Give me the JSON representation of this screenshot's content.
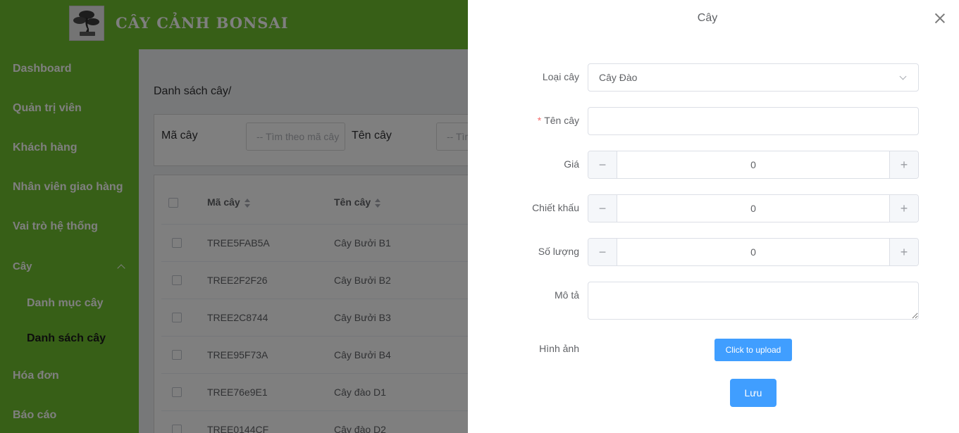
{
  "header": {
    "brand": "CÂY CẢNH BONSAI",
    "logo_icon": "bonsai-tree-icon"
  },
  "sidebar": {
    "items": [
      {
        "label": "Dashboard"
      },
      {
        "label": "Quản trị viên"
      },
      {
        "label": "Khách hàng"
      },
      {
        "label": "Nhân viên giao hàng"
      },
      {
        "label": "Vai trò hệ thống"
      },
      {
        "label": "Cây"
      },
      {
        "label": "Hóa đơn"
      },
      {
        "label": "Báo cáo"
      }
    ],
    "sub_items": [
      {
        "label": "Danh mục cây"
      },
      {
        "label": "Danh sách cây",
        "active": true
      }
    ]
  },
  "main": {
    "breadcrumb": "Danh sách cây/",
    "filters": {
      "code_label": "Mã cây",
      "code_placeholder": "-- Tìm theo mã cây",
      "name_label": "Tên cây",
      "name_placeholder": "-- Tìm theo tên cây"
    },
    "table": {
      "columns": [
        "Mã cây",
        "Tên cây"
      ],
      "rows": [
        {
          "code": "TREE5FAB5A",
          "name": "Cây Bưởi B1"
        },
        {
          "code": "TREE2F2F26",
          "name": "Cây Bưởi B2"
        },
        {
          "code": "TREE2C8744",
          "name": "Cây Bưởi B3"
        },
        {
          "code": "TREE95F73A",
          "name": "Cây Bưởi B4"
        },
        {
          "code": "TREE76e9E1",
          "name": "Cây đào D1"
        },
        {
          "code": "TREE0144CF",
          "name": "Cây đào D2"
        }
      ]
    }
  },
  "drawer": {
    "title": "Cây",
    "fields": {
      "category_label": "Loại cây",
      "category_value": "Cây Đào",
      "name_label": "Tên cây",
      "name_value": "",
      "price_label": "Giá",
      "price_value": "0",
      "discount_label": "Chiết khấu",
      "discount_value": "0",
      "quantity_label": "Số lượng",
      "quantity_value": "0",
      "description_label": "Mô tả",
      "description_value": "",
      "image_label": "Hình ảnh"
    },
    "upload_label": "Click to upload",
    "save_label": "Lưu",
    "stepper_minus": "−",
    "stepper_plus": "+"
  },
  "colors": {
    "brand_green": "#6fbf2e",
    "primary_blue": "#409eff",
    "required_red": "#f56c6c"
  }
}
